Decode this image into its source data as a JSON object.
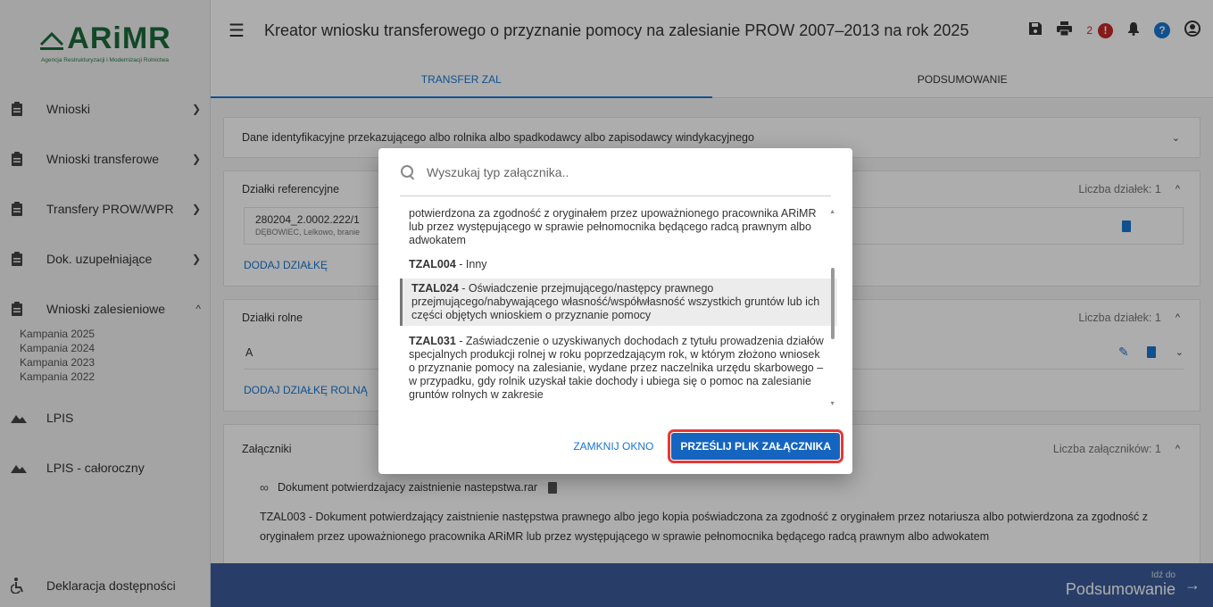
{
  "logo": {
    "name": "ARiMR",
    "subtitle": "Agencja Restrukturyzacji i Modernizacji Rolnictwa"
  },
  "colors": {
    "accent": "#1976d2",
    "footer": "#3b5c9a",
    "primary_button": "#1565c0",
    "highlight": "#e53935"
  },
  "sidebar": {
    "items": [
      {
        "label": "Wnioski",
        "icon": "clipboard-icon",
        "chevron": "down"
      },
      {
        "label": "Wnioski transferowe",
        "icon": "clipboard-icon",
        "chevron": "down"
      },
      {
        "label": "Transfery PROW/WPR",
        "icon": "clipboard-icon",
        "chevron": "down"
      },
      {
        "label": "Dok. uzupełniające",
        "icon": "clipboard-icon",
        "chevron": "down"
      },
      {
        "label": "Wnioski zalesieniowe",
        "icon": "clipboard-icon",
        "chevron": "up"
      },
      {
        "label": "LPIS",
        "icon": "mountain-icon"
      },
      {
        "label": "LPIS - całoroczny",
        "icon": "mountain-icon"
      },
      {
        "label": "Deklaracja dostępności",
        "icon": "accessibility-icon"
      }
    ],
    "campaigns": [
      "Kampania 2025",
      "Kampania 2024",
      "Kampania 2023",
      "Kampania 2022"
    ]
  },
  "header": {
    "title": "Kreator wniosku transferowego o przyznanie pomocy na zalesianie PROW 2007–2013 na rok 2025",
    "notification_count": "2",
    "alert_symbol": "!",
    "help_symbol": "?",
    "tabs": [
      {
        "label": "TRANSFER ZAL",
        "active": true
      },
      {
        "label": "PODSUMOWANIE",
        "active": false
      }
    ]
  },
  "main": {
    "identity_card": {
      "title": "Dane identyfikacyjne przekazującego albo rolnika albo spadkodawcy albo zapisodawcy windykacyjnego"
    },
    "reference_card": {
      "title": "Działki referencyjne",
      "count": "Liczba działek: 1",
      "row_main": "280204_2.0002.222/1",
      "row_sub": "DĘBOWIEC, Lelkowo, branie",
      "add_label": "DODAJ DZIAŁKĘ"
    },
    "agri_card": {
      "title": "Działki rolne",
      "count": "Liczba działek: 1",
      "row_name": "A",
      "add_label": "DODAJ DZIAŁKĘ ROLNĄ"
    },
    "attachments_card": {
      "title": "Załączniki",
      "count": "Liczba załączników: 1",
      "file_name": "Dokument potwierdzajacy zaistnienie nastepstwa.rar",
      "desc": "TZAL003 - Dokument potwierdzający zaistnienie następstwa prawnego albo jego kopia poświadczona za zgodność z oryginałem przez notariusza albo potwierdzona za zgodność z oryginałem przez upoważnionego pracownika ARiMR lub przez występującego w sprawie pełnomocnika będącego radcą prawnym albo adwokatem"
    }
  },
  "footer": {
    "small": "Idź do",
    "big": "Podsumowanie"
  },
  "dialog": {
    "search_placeholder": "Wyszukaj typ załącznika..",
    "options": [
      {
        "code": "",
        "text": "potwierdzona za zgodność z oryginałem przez upoważnionego pracownika ARiMR lub przez występującego w sprawie pełnomocnika będącego radcą prawnym albo adwokatem"
      },
      {
        "code": "TZAL004",
        "text": " - Inny"
      },
      {
        "code": "TZAL024",
        "text": " - Oświadczenie przejmującego/następcy prawnego przejmującego/nabywającego własność/współwłasność wszystkich gruntów lub ich części objętych wnioskiem o przyznanie pomocy",
        "selected": true
      },
      {
        "code": "TZAL031",
        "text": " - Zaświadczenie o uzyskiwanych dochodach z tytułu prowadzenia działów specjalnych produkcji rolnej w roku poprzedzającym rok, w którym złożono wniosek o przyznanie pomocy na zalesianie, wydane przez naczelnika urzędu skarbowego – w przypadku, gdy rolnik uzyskał takie dochody i ubiega się o pomoc na zalesianie gruntów rolnych w zakresie"
      }
    ],
    "close_label": "ZAMKNIJ OKNO",
    "submit_label": "PRZEŚLIJ PLIK ZAŁĄCZNIKA"
  }
}
